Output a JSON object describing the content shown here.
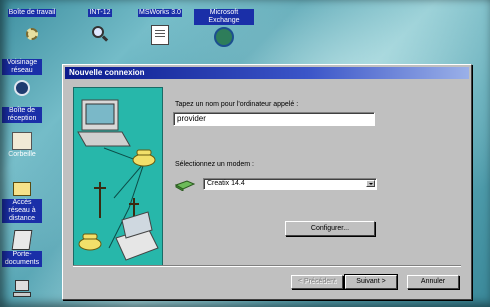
{
  "desktop": {
    "top_labels": [
      "Boîte de travail",
      "INT-12",
      "MSWorks 3.0",
      "Microsoft Exchange"
    ],
    "left_icons": [
      {
        "label": "Voisinage réseau",
        "icon": "network-neighborhood-icon"
      },
      {
        "label": "Boîte de réception",
        "icon": "inbox-icon"
      },
      {
        "label": "Corbeille",
        "icon": "recycle-bin-icon"
      },
      {
        "label": "Accès réseau à distance",
        "icon": "dial-up-networking-icon"
      },
      {
        "label": "Porte-documents",
        "icon": "briefcase-icon"
      }
    ]
  },
  "dialog": {
    "title": "Nouvelle connexion",
    "name_prompt": "Tapez un nom pour l'ordinateur appelé :",
    "name_value": "provider",
    "modem_prompt": "Sélectionnez un modem :",
    "modem_value": "Creatix 14.4",
    "configure_label": "Configurer...",
    "back_label": "< Précédent",
    "next_label": "Suivant >",
    "cancel_label": "Annuler"
  }
}
